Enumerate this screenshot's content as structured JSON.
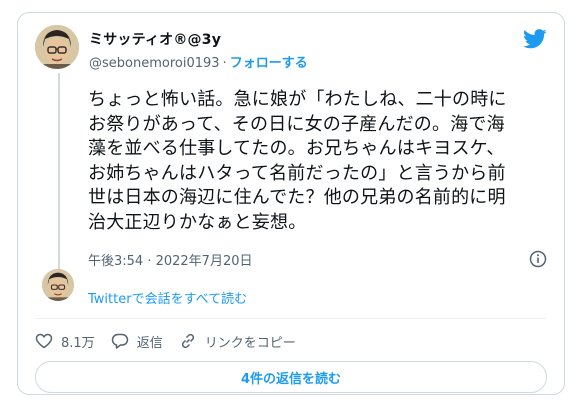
{
  "author": {
    "display_name": "ミサッティオ®@3y",
    "handle": "@sebonemoroi0193",
    "separator": "·",
    "follow_label": "フォローする"
  },
  "tweet": {
    "text": "ちょっと怖い話。急に娘が「わたしね、二十の時に\nお祭りがあって、その日に女の子産んだの。海で海\n藻を並べる仕事してたの。お兄ちゃんはキヨスケ、\nお姉ちゃんはハタって名前だったの」と言うから前\n世は日本の海辺に住んでた？他の兄弟の名前的に明\n治大正辺りかなぁと妄想。",
    "timestamp": "午後3:54 · 2022年7月20日"
  },
  "thread": {
    "read_conversation_label": "Twitterで会話をすべて読む"
  },
  "actions": {
    "likes": "8.1万",
    "reply_label": "返信",
    "copy_link_label": "リンクをコピー"
  },
  "replies_button_label": "4件の返信を読む",
  "icons": [
    "twitter-bird-icon",
    "info-icon",
    "heart-icon",
    "reply-icon",
    "link-icon"
  ],
  "colors": {
    "accent": "#1d9bf0",
    "secondary_text": "#536471",
    "border": "#cfd9de"
  }
}
